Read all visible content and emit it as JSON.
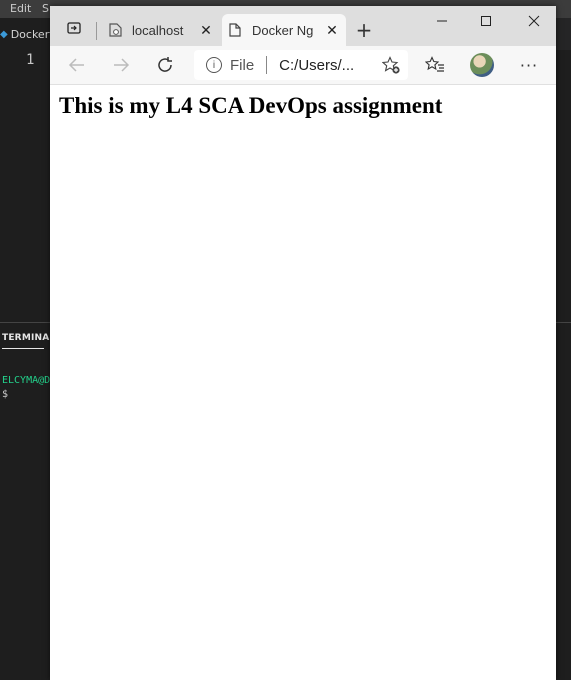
{
  "vscode": {
    "menu": [
      "Edit",
      "S"
    ],
    "tab_label": "Dockerfi",
    "line_numbers": [
      "1"
    ],
    "panel_tab": "TERMINAL",
    "terminal_prompt": "ELCYMA@D",
    "terminal_line": "$"
  },
  "browser": {
    "tabs": [
      {
        "title": "localhost",
        "active": false
      },
      {
        "title": "Docker Ng",
        "active": true
      }
    ],
    "new_tab": "+",
    "address": {
      "scheme": "File",
      "url": "C:/Users/..."
    },
    "page": {
      "heading": "This is my L4 SCA DevOps assignment"
    }
  },
  "icons": {
    "tab_actions": "tab-actions-icon",
    "close": "close-icon",
    "minimize": "minimize-icon",
    "maximize": "maximize-icon",
    "back": "back-arrow-icon",
    "forward": "forward-arrow-icon",
    "refresh": "refresh-icon",
    "info": "info-icon",
    "add_favorite": "add-favorite-icon",
    "favorites": "favorites-icon",
    "more": "more-icon"
  },
  "colors": {
    "vscode_bg": "#1e1e1e",
    "terminal_prompt": "#23d18b",
    "browser_titlebar": "#dedede",
    "browser_toolbar": "#f7f7f7"
  }
}
